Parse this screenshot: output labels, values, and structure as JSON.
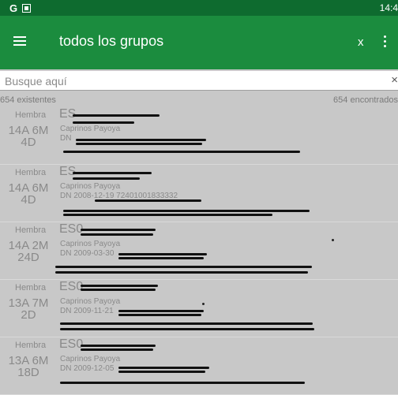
{
  "status_bar": {
    "g_letter": "G",
    "time": "14:4",
    "icons": [
      "google-icon",
      "notification-box-icon"
    ]
  },
  "app_bar": {
    "title": "todos los grupos",
    "x_action": "x",
    "menu_icon": "hamburger-icon",
    "overflow_icon": "more-vert-icon"
  },
  "search": {
    "placeholder": "Busque aquí",
    "value": "",
    "clear_icon": "×"
  },
  "counts": {
    "left": "654 existentes",
    "right": "654 encontrados"
  },
  "animals": [
    {
      "sex": "Hembra",
      "age": [
        "14A 6M",
        "4D"
      ],
      "id": "ES",
      "group": "Caprinos Payoya",
      "dn": "DN"
    },
    {
      "sex": "Hembra",
      "age": [
        "14A 6M",
        "4D"
      ],
      "id": "ES",
      "group": "Caprinos Payoya",
      "dn": "DN 2008-12-19 72401001833332"
    },
    {
      "sex": "Hembra",
      "age": [
        "14A 2M",
        "24D"
      ],
      "id": "ES0",
      "group": "Caprinos Payoya",
      "dn": "DN 2009-03-30"
    },
    {
      "sex": "Hembra",
      "age": [
        "13A 7M",
        "2D"
      ],
      "id": "ES0",
      "group": "Caprinos Payoya",
      "dn": "DN 2009-11-21"
    },
    {
      "sex": "Hembra",
      "age": [
        "13A 6M",
        "18D"
      ],
      "id": "ES0",
      "group": "Caprinos Payoya",
      "dn": "DN 2009-12-05"
    }
  ]
}
